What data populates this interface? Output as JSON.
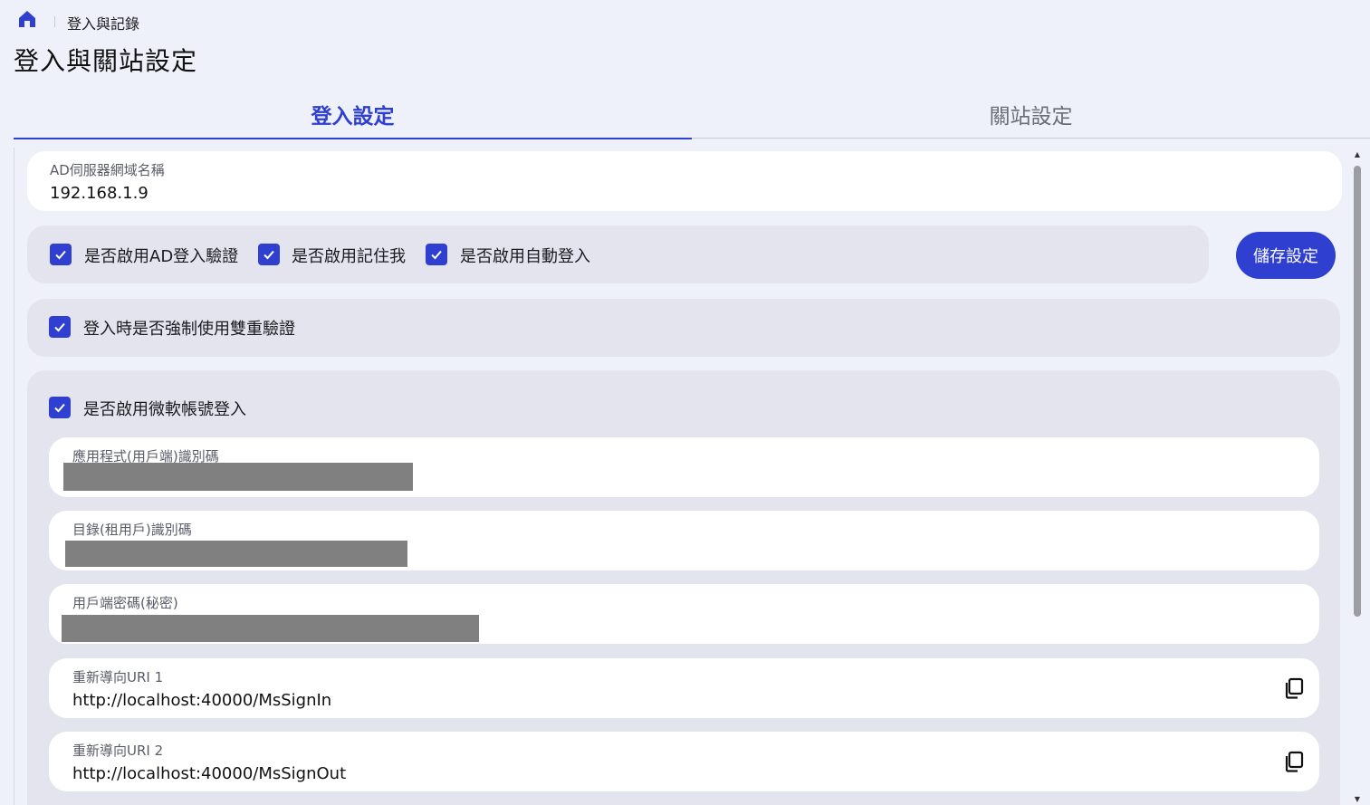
{
  "breadcrumb": {
    "current": "登入與記錄"
  },
  "page": {
    "title": "登入與關站設定"
  },
  "tabs": [
    {
      "label": "登入設定",
      "active": true
    },
    {
      "label": "關站設定",
      "active": false
    }
  ],
  "ad_server": {
    "label": "AD伺服器網域名稱",
    "value": "192.168.1.9"
  },
  "options": {
    "enable_ad_login": "是否啟用AD登入驗證",
    "enable_remember_me": "是否啟用記住我",
    "enable_auto_login": "是否啟用自動登入"
  },
  "save_button": "儲存設定",
  "force_2fa": "登入時是否強制使用雙重驗證",
  "microsoft": {
    "enable_label": "是否啟用微軟帳號登入",
    "client_id_label": "應用程式(用戶端)識別碼",
    "tenant_id_label": "目錄(租用戶)識別碼",
    "client_secret_label": "用戶端密碼(秘密)",
    "redirect_uri_1_label": "重新導向URI 1",
    "redirect_uri_1_value": "http://localhost:40000/MsSignIn",
    "redirect_uri_2_label": "重新導向URI 2",
    "redirect_uri_2_value": "http://localhost:40000/MsSignOut"
  },
  "icons": {
    "home": "home-icon",
    "checkbox": "check-icon",
    "copy": "copy-icon"
  },
  "colors": {
    "accent": "#2f3fd0",
    "background": "#eef1fa",
    "panel": "#e4e4ee",
    "redaction": "#808080"
  }
}
